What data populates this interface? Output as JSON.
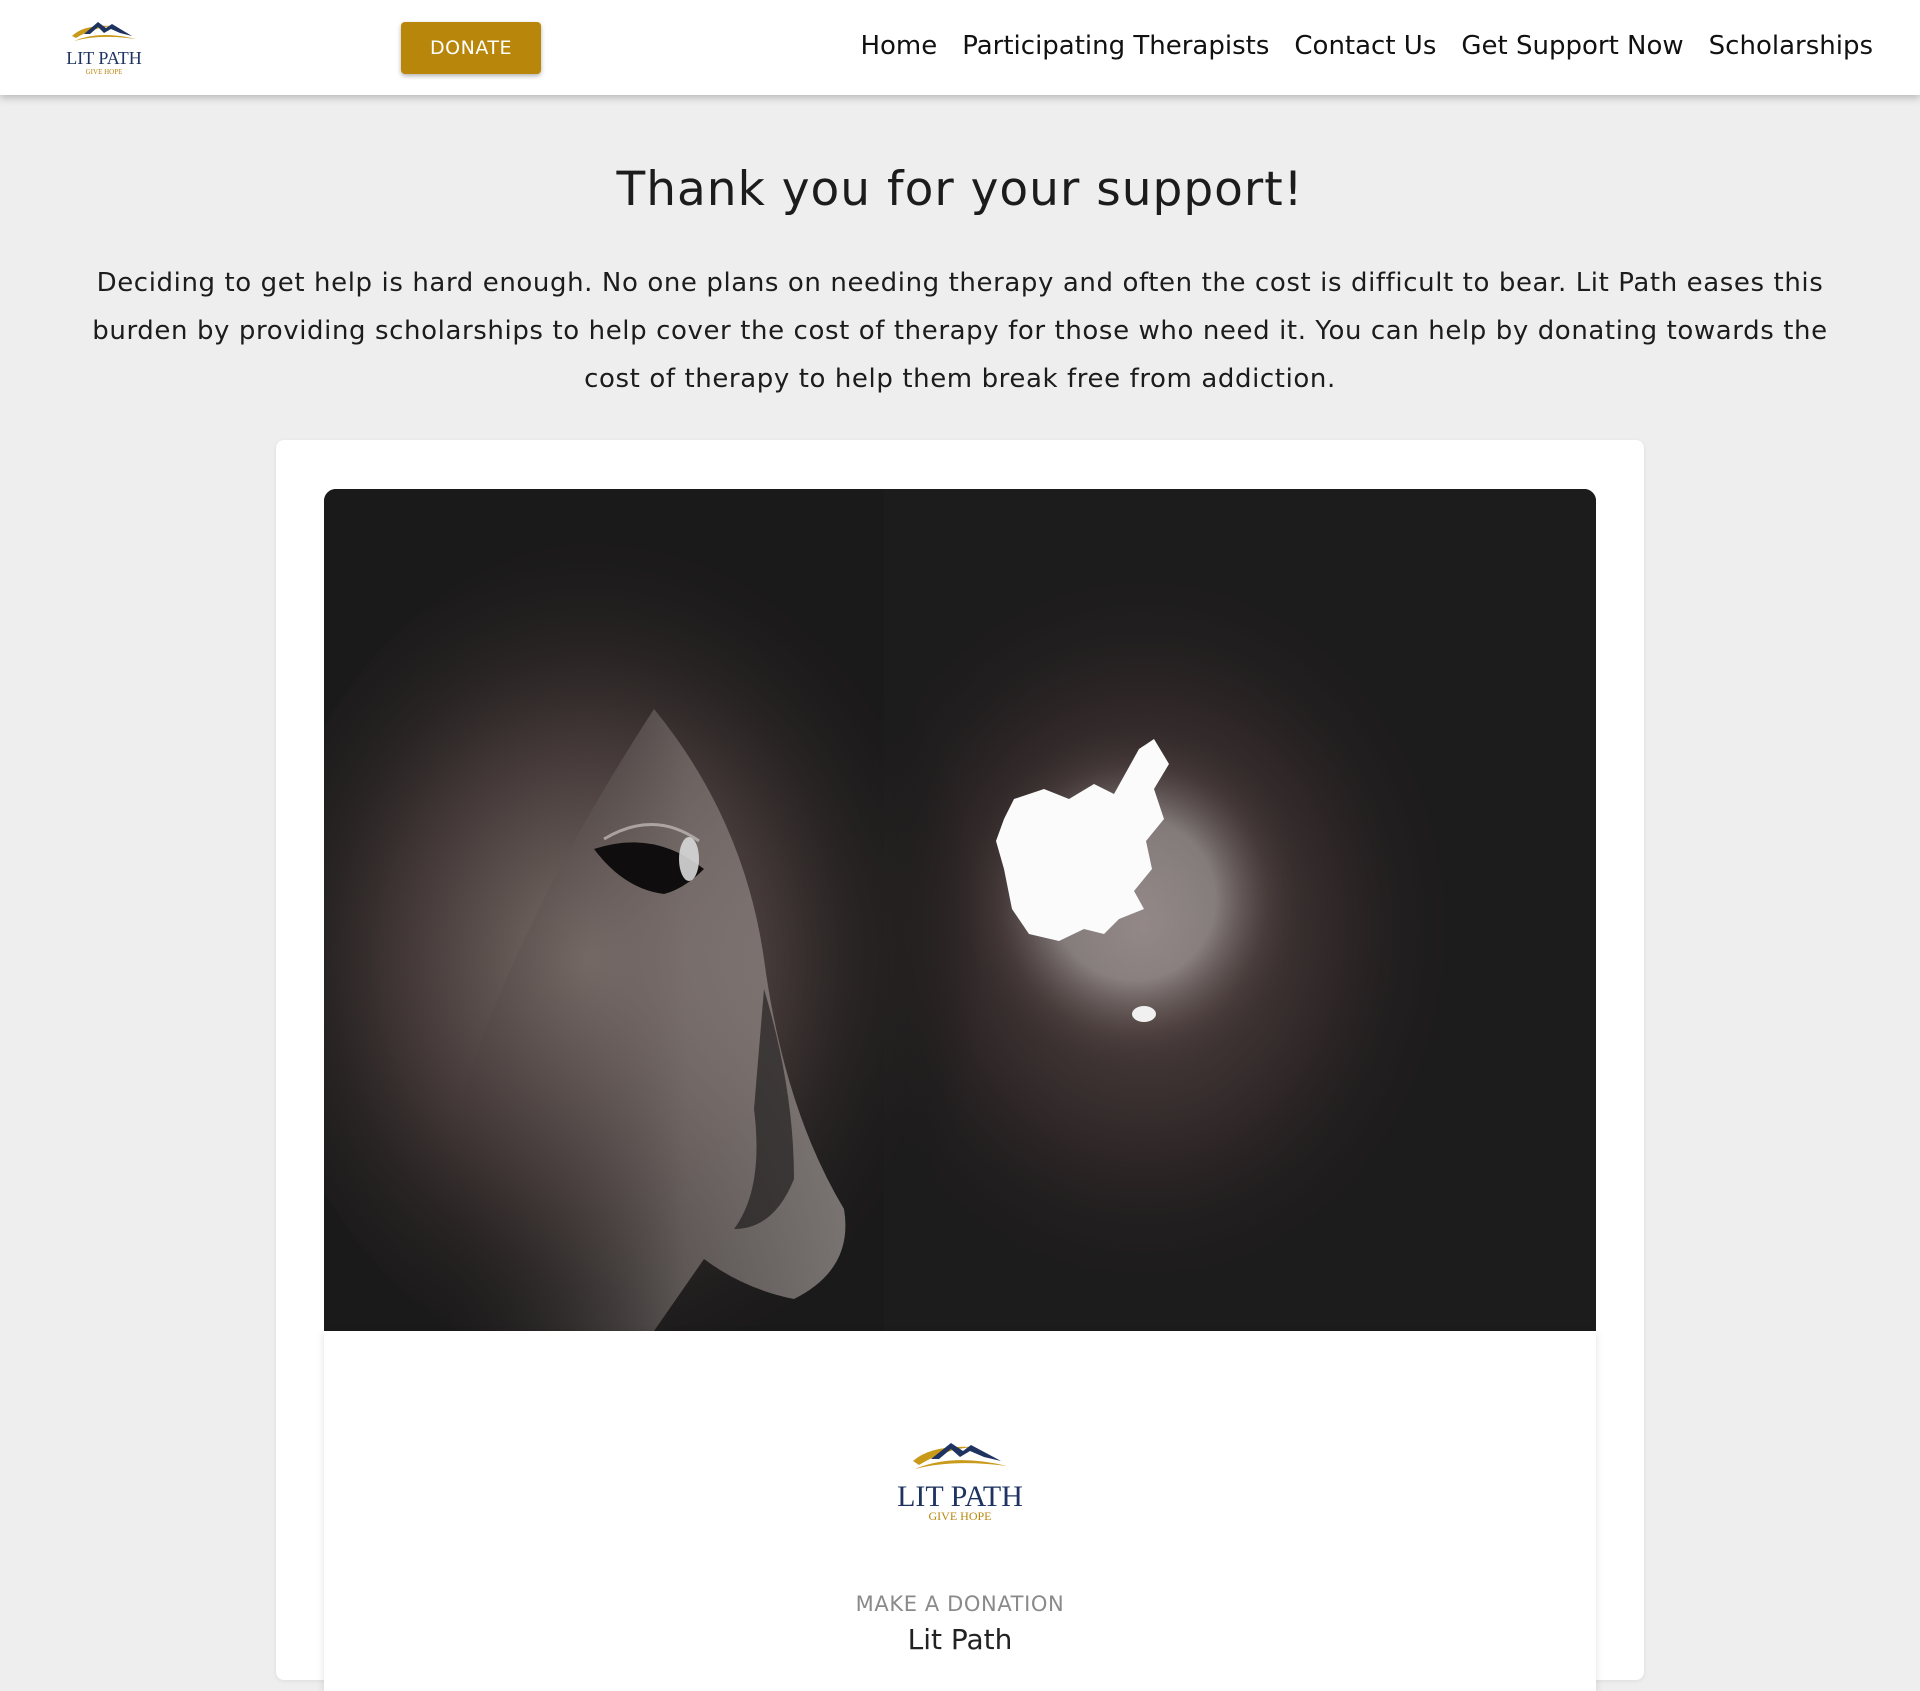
{
  "header": {
    "logo": {
      "name": "LIT PATH",
      "tagline": "GIVE HOPE"
    },
    "donate_label": "DONATE",
    "nav": [
      "Home",
      "Participating Therapists",
      "Contact Us",
      "Get Support Now",
      "Scholarships"
    ]
  },
  "main": {
    "title": "Thank you for your support!",
    "intro": "Deciding to get help is hard enough. No one plans on needing therapy and often the cost is difficult to bear. Lit Path eases this burden by providing scholarships to help cover the cost of therapy for those who need it. You can help by donating towards the cost of therapy to help them break free from addiction."
  },
  "donation_card": {
    "logo": {
      "name": "LIT PATH",
      "tagline": "GIVE HOPE"
    },
    "section_label": "MAKE A DONATION",
    "org_name": "Lit Path"
  },
  "colors": {
    "accent": "#b8860b",
    "brand_navy": "#1f3361",
    "page_bg": "#eeeeee",
    "button_text": "#ffffff"
  },
  "icons": [
    "mountain-logo-icon"
  ]
}
